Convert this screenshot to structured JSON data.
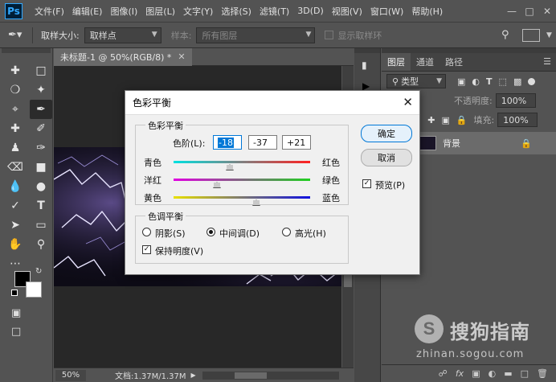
{
  "app": {
    "logo": "Ps"
  },
  "menu": [
    "文件(F)",
    "编辑(E)",
    "图像(I)",
    "图层(L)",
    "文字(Y)",
    "选择(S)",
    "滤镜(T)",
    "3D(D)",
    "视图(V)",
    "窗口(W)",
    "帮助(H)"
  ],
  "options": {
    "sample_size_label": "取样大小:",
    "sample_size_value": "取样点",
    "sample_label": "样本:",
    "sample_value": "所有图层",
    "show_ring_label": "显示取样环"
  },
  "document": {
    "tab_title": "未标题-1 @ 50%(RGB/8) *",
    "zoom": "50%",
    "doc_info": "文档:1.37M/1.37M"
  },
  "layers_panel": {
    "tabs": [
      "图层",
      "通道",
      "路径"
    ],
    "filter_kind": "类型",
    "opacity_label": "不透明度:",
    "opacity_value": "100%",
    "fill_label": "填充:",
    "fill_value": "100%",
    "layer_name": "背景"
  },
  "dialog": {
    "title": "色彩平衡",
    "balance_group": "色彩平衡",
    "levels_label": "色阶(L):",
    "levels": [
      "-18",
      "-37",
      "+21"
    ],
    "sliders": [
      {
        "left": "青色",
        "right": "红色",
        "value": -18
      },
      {
        "left": "洋红",
        "right": "绿色",
        "value": -37
      },
      {
        "left": "黄色",
        "right": "蓝色",
        "value": 21
      }
    ],
    "tone_group": "色调平衡",
    "tones": [
      "阴影(S)",
      "中间调(D)",
      "高光(H)"
    ],
    "tone_selected": "中间调(D)",
    "preserve_label": "保持明度(V)",
    "ok": "确定",
    "cancel": "取消",
    "preview": "预览(P)"
  },
  "watermark": {
    "brand": "搜狗指南",
    "url": "zhinan.sogou.com"
  },
  "colors": {
    "accent": "#0078d7",
    "ps_bg": "#535353",
    "dialog_bg": "#f0f0f0"
  }
}
